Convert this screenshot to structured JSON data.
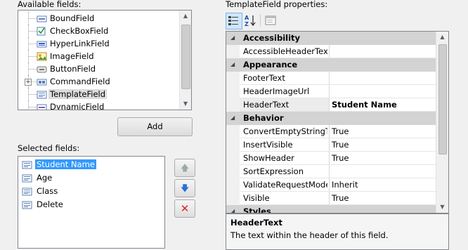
{
  "available_fields": {
    "label": "Available fields:",
    "items": [
      {
        "label": "BoundField",
        "icon": "boundfield-icon"
      },
      {
        "label": "CheckBoxField",
        "icon": "checkboxfield-icon"
      },
      {
        "label": "HyperLinkField",
        "icon": "hyperlinkfield-icon"
      },
      {
        "label": "ImageField",
        "icon": "imagefield-icon"
      },
      {
        "label": "ButtonField",
        "icon": "buttonfield-icon"
      },
      {
        "label": "CommandField",
        "icon": "commandfield-icon",
        "expandable": true
      },
      {
        "label": "TemplateField",
        "icon": "templatefield-icon",
        "selected": true
      },
      {
        "label": "DynamicField",
        "icon": "dynamicfield-icon"
      }
    ]
  },
  "add_button": {
    "label": "Add"
  },
  "selected_fields": {
    "label": "Selected fields:",
    "items": [
      {
        "label": "Student Name",
        "active": true
      },
      {
        "label": "Age"
      },
      {
        "label": "Class"
      },
      {
        "label": "Delete"
      }
    ]
  },
  "side_buttons": {
    "up": "move-up-icon",
    "down": "move-down-icon",
    "delete": "delete-icon"
  },
  "properties": {
    "label": "TemplateField properties:",
    "rows": [
      {
        "kind": "cat",
        "name": "Accessibility"
      },
      {
        "kind": "prop",
        "name": "AccessibleHeaderText",
        "value": ""
      },
      {
        "kind": "cat",
        "name": "Appearance"
      },
      {
        "kind": "prop",
        "name": "FooterText",
        "value": ""
      },
      {
        "kind": "prop",
        "name": "HeaderImageUrl",
        "value": ""
      },
      {
        "kind": "prop",
        "name": "HeaderText",
        "value": "Student Name",
        "bold": true,
        "highlight": true
      },
      {
        "kind": "cat",
        "name": "Behavior"
      },
      {
        "kind": "prop",
        "name": "ConvertEmptyStringTo",
        "value": "True"
      },
      {
        "kind": "prop",
        "name": "InsertVisible",
        "value": "True"
      },
      {
        "kind": "prop",
        "name": "ShowHeader",
        "value": "True"
      },
      {
        "kind": "prop",
        "name": "SortExpression",
        "value": ""
      },
      {
        "kind": "prop",
        "name": "ValidateRequestMode",
        "value": "Inherit"
      },
      {
        "kind": "prop",
        "name": "Visible",
        "value": "True"
      },
      {
        "kind": "cat",
        "name": "Styles"
      }
    ],
    "description": {
      "title": "HeaderText",
      "text": "The text within the header of this field."
    }
  }
}
